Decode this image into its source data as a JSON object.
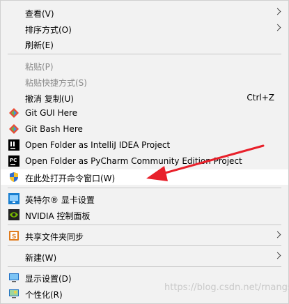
{
  "menu": {
    "view": {
      "label": "查看(V)"
    },
    "sort": {
      "label": "排序方式(O)"
    },
    "refresh": {
      "label": "刷新(E)"
    },
    "paste": {
      "label": "粘贴(P)"
    },
    "paste_shortcut": {
      "label": "粘贴快捷方式(S)"
    },
    "undo": {
      "label": "撤消 复制(U)",
      "shortcut": "Ctrl+Z"
    },
    "git_gui": {
      "label": "Git GUI Here"
    },
    "git_bash": {
      "label": "Git Bash Here"
    },
    "idea": {
      "label": "Open Folder as IntelliJ IDEA Project"
    },
    "pycharm": {
      "label": "Open Folder as PyCharm Community Edition Project"
    },
    "cmd": {
      "label": "在此处打开命令窗口(W)"
    },
    "intel": {
      "label": "英特尔® 显卡设置"
    },
    "nvidia": {
      "label": "NVIDIA 控制面板"
    },
    "share_sync": {
      "label": "共享文件夹同步"
    },
    "new": {
      "label": "新建(W)"
    },
    "display": {
      "label": "显示设置(D)"
    },
    "personalize": {
      "label": "个性化(R)"
    }
  },
  "watermark": "https://blog.csdn.net/rnangs",
  "colors": {
    "highlight": "#ffffff",
    "arrow": "#e8202a",
    "menu_bg": "#f2f2f2"
  }
}
